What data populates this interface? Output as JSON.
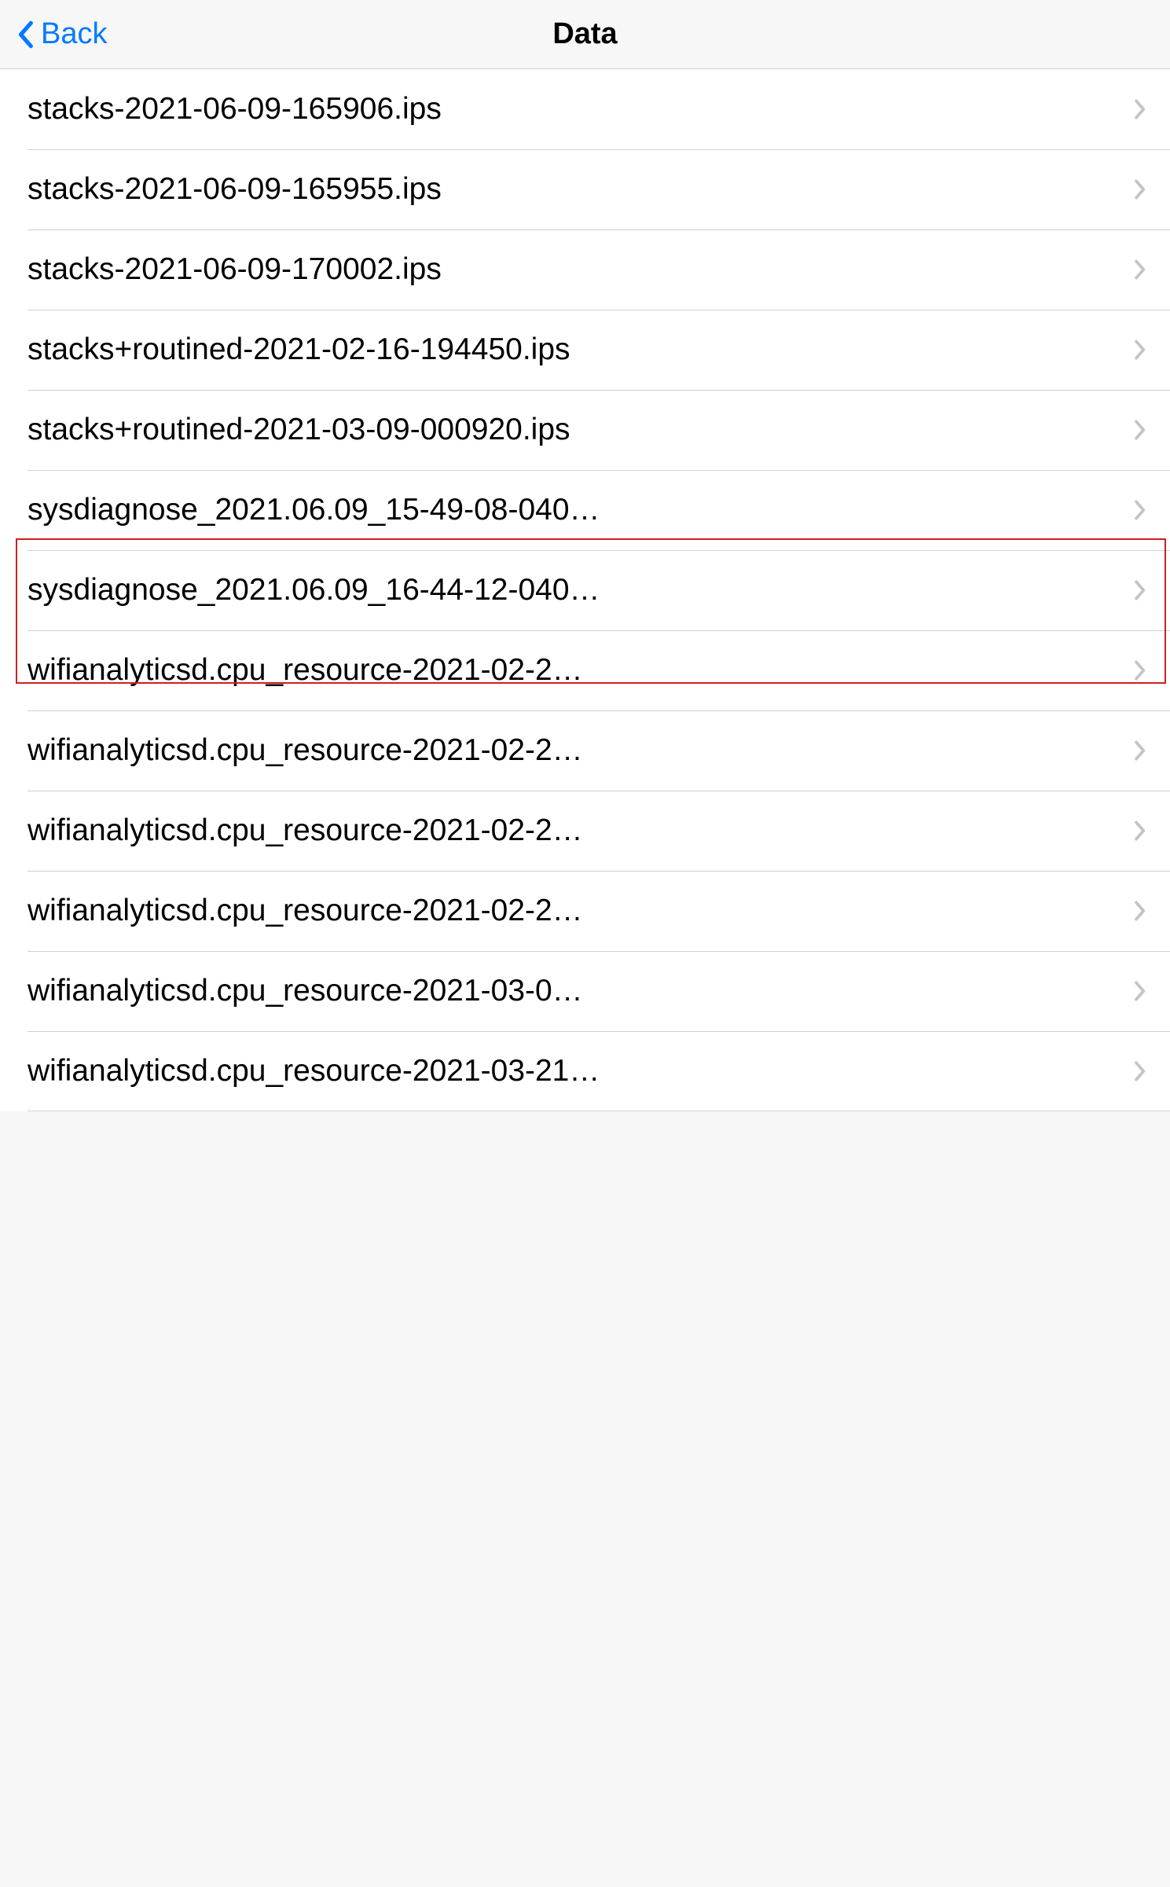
{
  "nav": {
    "back_label": "Back",
    "title": "Data"
  },
  "rows": [
    {
      "label": "stacks-2021-06-09-165906.ips"
    },
    {
      "label": "stacks-2021-06-09-165955.ips"
    },
    {
      "label": "stacks-2021-06-09-170002.ips"
    },
    {
      "label": "stacks+routined-2021-02-16-194450.ips"
    },
    {
      "label": "stacks+routined-2021-03-09-000920.ips"
    },
    {
      "label": "sysdiagnose_2021.06.09_15-49-08-040…"
    },
    {
      "label": "sysdiagnose_2021.06.09_16-44-12-040…"
    },
    {
      "label": "wifianalyticsd.cpu_resource-2021-02-2…"
    },
    {
      "label": "wifianalyticsd.cpu_resource-2021-02-2…"
    },
    {
      "label": "wifianalyticsd.cpu_resource-2021-02-2…"
    },
    {
      "label": "wifianalyticsd.cpu_resource-2021-02-2…"
    },
    {
      "label": "wifianalyticsd.cpu_resource-2021-03-0…"
    },
    {
      "label": "wifianalyticsd.cpu_resource-2021-03-21…"
    }
  ],
  "highlight": {
    "start_index": 5,
    "end_index": 6
  }
}
